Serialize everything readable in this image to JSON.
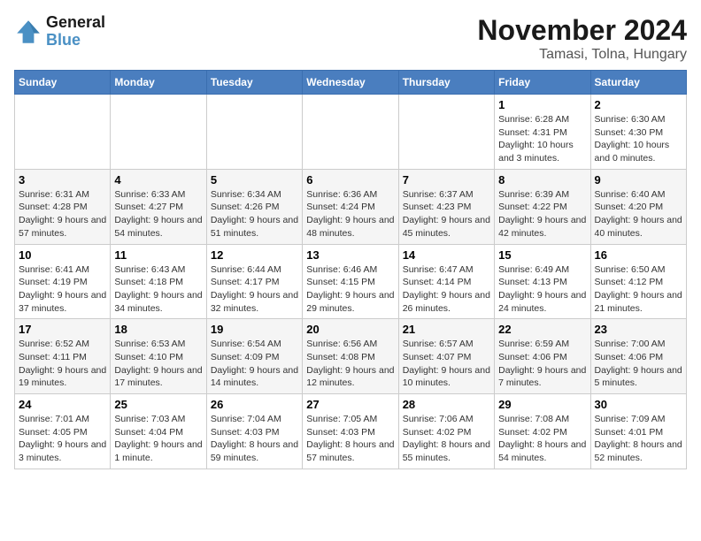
{
  "header": {
    "logo_line1": "General",
    "logo_line2": "Blue",
    "month_title": "November 2024",
    "location": "Tamasi, Tolna, Hungary"
  },
  "weekdays": [
    "Sunday",
    "Monday",
    "Tuesday",
    "Wednesday",
    "Thursday",
    "Friday",
    "Saturday"
  ],
  "weeks": [
    [
      {
        "day": "",
        "info": ""
      },
      {
        "day": "",
        "info": ""
      },
      {
        "day": "",
        "info": ""
      },
      {
        "day": "",
        "info": ""
      },
      {
        "day": "",
        "info": ""
      },
      {
        "day": "1",
        "info": "Sunrise: 6:28 AM\nSunset: 4:31 PM\nDaylight: 10 hours and 3 minutes."
      },
      {
        "day": "2",
        "info": "Sunrise: 6:30 AM\nSunset: 4:30 PM\nDaylight: 10 hours and 0 minutes."
      }
    ],
    [
      {
        "day": "3",
        "info": "Sunrise: 6:31 AM\nSunset: 4:28 PM\nDaylight: 9 hours and 57 minutes."
      },
      {
        "day": "4",
        "info": "Sunrise: 6:33 AM\nSunset: 4:27 PM\nDaylight: 9 hours and 54 minutes."
      },
      {
        "day": "5",
        "info": "Sunrise: 6:34 AM\nSunset: 4:26 PM\nDaylight: 9 hours and 51 minutes."
      },
      {
        "day": "6",
        "info": "Sunrise: 6:36 AM\nSunset: 4:24 PM\nDaylight: 9 hours and 48 minutes."
      },
      {
        "day": "7",
        "info": "Sunrise: 6:37 AM\nSunset: 4:23 PM\nDaylight: 9 hours and 45 minutes."
      },
      {
        "day": "8",
        "info": "Sunrise: 6:39 AM\nSunset: 4:22 PM\nDaylight: 9 hours and 42 minutes."
      },
      {
        "day": "9",
        "info": "Sunrise: 6:40 AM\nSunset: 4:20 PM\nDaylight: 9 hours and 40 minutes."
      }
    ],
    [
      {
        "day": "10",
        "info": "Sunrise: 6:41 AM\nSunset: 4:19 PM\nDaylight: 9 hours and 37 minutes."
      },
      {
        "day": "11",
        "info": "Sunrise: 6:43 AM\nSunset: 4:18 PM\nDaylight: 9 hours and 34 minutes."
      },
      {
        "day": "12",
        "info": "Sunrise: 6:44 AM\nSunset: 4:17 PM\nDaylight: 9 hours and 32 minutes."
      },
      {
        "day": "13",
        "info": "Sunrise: 6:46 AM\nSunset: 4:15 PM\nDaylight: 9 hours and 29 minutes."
      },
      {
        "day": "14",
        "info": "Sunrise: 6:47 AM\nSunset: 4:14 PM\nDaylight: 9 hours and 26 minutes."
      },
      {
        "day": "15",
        "info": "Sunrise: 6:49 AM\nSunset: 4:13 PM\nDaylight: 9 hours and 24 minutes."
      },
      {
        "day": "16",
        "info": "Sunrise: 6:50 AM\nSunset: 4:12 PM\nDaylight: 9 hours and 21 minutes."
      }
    ],
    [
      {
        "day": "17",
        "info": "Sunrise: 6:52 AM\nSunset: 4:11 PM\nDaylight: 9 hours and 19 minutes."
      },
      {
        "day": "18",
        "info": "Sunrise: 6:53 AM\nSunset: 4:10 PM\nDaylight: 9 hours and 17 minutes."
      },
      {
        "day": "19",
        "info": "Sunrise: 6:54 AM\nSunset: 4:09 PM\nDaylight: 9 hours and 14 minutes."
      },
      {
        "day": "20",
        "info": "Sunrise: 6:56 AM\nSunset: 4:08 PM\nDaylight: 9 hours and 12 minutes."
      },
      {
        "day": "21",
        "info": "Sunrise: 6:57 AM\nSunset: 4:07 PM\nDaylight: 9 hours and 10 minutes."
      },
      {
        "day": "22",
        "info": "Sunrise: 6:59 AM\nSunset: 4:06 PM\nDaylight: 9 hours and 7 minutes."
      },
      {
        "day": "23",
        "info": "Sunrise: 7:00 AM\nSunset: 4:06 PM\nDaylight: 9 hours and 5 minutes."
      }
    ],
    [
      {
        "day": "24",
        "info": "Sunrise: 7:01 AM\nSunset: 4:05 PM\nDaylight: 9 hours and 3 minutes."
      },
      {
        "day": "25",
        "info": "Sunrise: 7:03 AM\nSunset: 4:04 PM\nDaylight: 9 hours and 1 minute."
      },
      {
        "day": "26",
        "info": "Sunrise: 7:04 AM\nSunset: 4:03 PM\nDaylight: 8 hours and 59 minutes."
      },
      {
        "day": "27",
        "info": "Sunrise: 7:05 AM\nSunset: 4:03 PM\nDaylight: 8 hours and 57 minutes."
      },
      {
        "day": "28",
        "info": "Sunrise: 7:06 AM\nSunset: 4:02 PM\nDaylight: 8 hours and 55 minutes."
      },
      {
        "day": "29",
        "info": "Sunrise: 7:08 AM\nSunset: 4:02 PM\nDaylight: 8 hours and 54 minutes."
      },
      {
        "day": "30",
        "info": "Sunrise: 7:09 AM\nSunset: 4:01 PM\nDaylight: 8 hours and 52 minutes."
      }
    ]
  ]
}
